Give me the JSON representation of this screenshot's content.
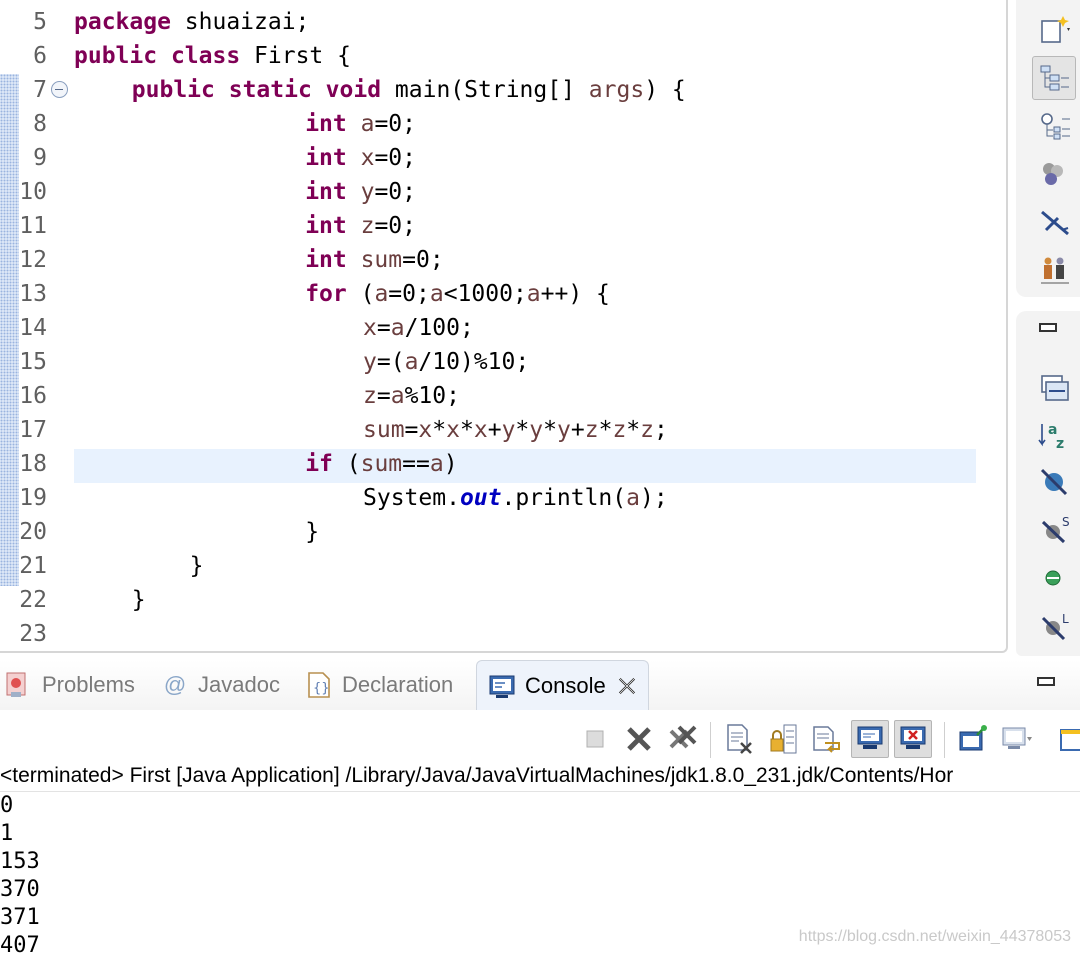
{
  "editor": {
    "lines": [
      {
        "num": "5",
        "tokens": [
          [
            "k",
            "package"
          ],
          [
            "",
            "shuaizai;"
          ]
        ]
      },
      {
        "num": "6",
        "tokens": [
          [
            "k",
            "public"
          ],
          [
            "k",
            "class"
          ],
          [
            "",
            "First {"
          ]
        ]
      },
      {
        "num": "7",
        "tokens": [
          [
            "k",
            "public"
          ],
          [
            "k",
            "static"
          ],
          [
            "k",
            "void"
          ],
          [
            "",
            "main(String[] "
          ],
          [
            "v",
            "args"
          ],
          [
            "",
            ") {"
          ]
        ]
      },
      {
        "num": "8",
        "tokens": [
          [
            "k",
            "int"
          ],
          [
            "v",
            "a"
          ],
          [
            "",
            "=0;"
          ]
        ]
      },
      {
        "num": "9",
        "tokens": [
          [
            "k",
            "int"
          ],
          [
            "v",
            "x"
          ],
          [
            "",
            "=0;"
          ]
        ]
      },
      {
        "num": "10",
        "tokens": [
          [
            "k",
            "int"
          ],
          [
            "v",
            "y"
          ],
          [
            "",
            "=0;"
          ]
        ]
      },
      {
        "num": "11",
        "tokens": [
          [
            "k",
            "int"
          ],
          [
            "v",
            "z"
          ],
          [
            "",
            "=0;"
          ]
        ]
      },
      {
        "num": "12",
        "tokens": [
          [
            "k",
            "int"
          ],
          [
            "v",
            "sum"
          ],
          [
            "",
            "=0;"
          ]
        ]
      },
      {
        "num": "13",
        "tokens": [
          [
            "k",
            "for"
          ],
          [
            "",
            "("
          ],
          [
            "v",
            "a"
          ],
          [
            "",
            "=0;"
          ],
          [
            "v",
            "a"
          ],
          [
            "",
            "<1000;"
          ],
          [
            "v",
            "a"
          ],
          [
            "",
            "++) {"
          ]
        ]
      },
      {
        "num": "14",
        "tokens": [
          [
            "v",
            "x"
          ],
          [
            "",
            "="
          ],
          [
            "v",
            "a"
          ],
          [
            "",
            "/100;"
          ]
        ]
      },
      {
        "num": "15",
        "tokens": [
          [
            "v",
            "y"
          ],
          [
            "",
            "=("
          ],
          [
            "v",
            "a"
          ],
          [
            "",
            "/10)%10;"
          ]
        ]
      },
      {
        "num": "16",
        "tokens": [
          [
            "v",
            "z"
          ],
          [
            "",
            "="
          ],
          [
            "v",
            "a"
          ],
          [
            "",
            "%10;"
          ]
        ]
      },
      {
        "num": "17",
        "tokens": [
          [
            "v",
            "sum"
          ],
          [
            "",
            "="
          ],
          [
            "v",
            "x"
          ],
          [
            "",
            "*"
          ],
          [
            "v",
            "x"
          ],
          [
            "",
            "*"
          ],
          [
            "v",
            "x"
          ],
          [
            "",
            "+"
          ],
          [
            "v",
            "y"
          ],
          [
            "",
            "*"
          ],
          [
            "v",
            "y"
          ],
          [
            "",
            "*"
          ],
          [
            "v",
            "y"
          ],
          [
            "",
            "+"
          ],
          [
            "v",
            "z"
          ],
          [
            "",
            "*"
          ],
          [
            "v",
            "z"
          ],
          [
            "",
            "*"
          ],
          [
            "v",
            "z"
          ],
          [
            "",
            ";"
          ]
        ]
      },
      {
        "num": "18",
        "tokens": [
          [
            "k",
            "if"
          ],
          [
            "",
            "("
          ],
          [
            "v",
            "sum"
          ],
          [
            "",
            "=="
          ],
          [
            "v",
            "a"
          ],
          [
            "",
            ")"
          ]
        ]
      },
      {
        "num": "19",
        "tokens": [
          [
            "",
            "System."
          ],
          [
            "f",
            "out"
          ],
          [
            "",
            ".println("
          ],
          [
            "v",
            "a"
          ],
          [
            "",
            ");"
          ]
        ]
      },
      {
        "num": "20",
        "tokens": [
          [
            "",
            "}"
          ]
        ]
      },
      {
        "num": "21",
        "tokens": [
          [
            "",
            "}"
          ]
        ]
      },
      {
        "num": "22",
        "tokens": [
          [
            "",
            "}"
          ]
        ]
      },
      {
        "num": "23",
        "tokens": []
      }
    ],
    "colors": {
      "keyword": "#7f0055",
      "variable": "#6a3e3e",
      "static_field": "#0000c0",
      "current_line": "#e8f2fe"
    }
  },
  "right_toolbar": {
    "top_icons": [
      "new-java-class-icon",
      "package-explorer-icon",
      "type-hierarchy-icon",
      "outline-icon",
      "debug-icon",
      "run-config-icon"
    ],
    "bottom_icons": [
      "restore-icon",
      "collapse-all-icon",
      "sort-alphabetical-icon",
      "hide-fields-icon",
      "hide-static-icon",
      "hide-non-public-icon",
      "hide-local-types-icon"
    ]
  },
  "views": {
    "tabs": [
      {
        "label": "Problems",
        "icon": "problems-icon"
      },
      {
        "label": "Javadoc",
        "icon": "at-sign-icon"
      },
      {
        "label": "Declaration",
        "icon": "declaration-icon"
      },
      {
        "label": "Console",
        "icon": "console-icon"
      }
    ],
    "active_tab": "Console"
  },
  "console": {
    "header": "<terminated> First [Java Application] /Library/Java/JavaVirtualMachines/jdk1.8.0_231.jdk/Contents/Hor",
    "output": [
      "0",
      "1",
      "153",
      "370",
      "371",
      "407"
    ],
    "toolbar_icons": [
      "terminate-icon",
      "remove-launch-icon",
      "remove-all-terminated-icon",
      "clear-console-icon",
      "scroll-lock-icon",
      "word-wrap-icon",
      "show-on-stdout-icon",
      "show-on-stderr-icon",
      "pin-console-icon",
      "display-console-icon",
      "new-console-icon"
    ]
  },
  "watermark": "https://blog.csdn.net/weixin_44378053"
}
